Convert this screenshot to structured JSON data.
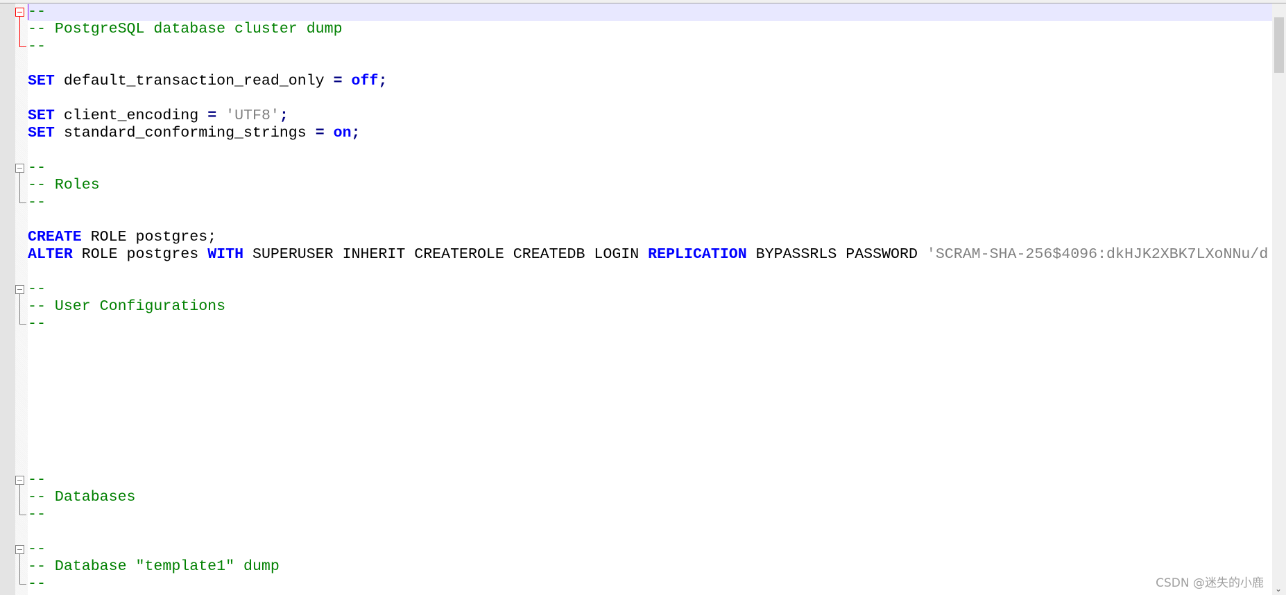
{
  "editor": {
    "lines": [
      [
        {
          "t": "--",
          "c": "cm"
        }
      ],
      [
        {
          "t": "-- PostgreSQL database cluster dump",
          "c": "cm"
        }
      ],
      [
        {
          "t": "--",
          "c": "cm"
        }
      ],
      [],
      [
        {
          "t": "SET",
          "c": "kw"
        },
        {
          "t": " default_transaction_read_only ",
          "c": ""
        },
        {
          "t": "=",
          "c": "op"
        },
        {
          "t": " ",
          "c": ""
        },
        {
          "t": "off",
          "c": "kw"
        },
        {
          "t": ";",
          "c": "op"
        }
      ],
      [],
      [
        {
          "t": "SET",
          "c": "kw"
        },
        {
          "t": " client_encoding ",
          "c": ""
        },
        {
          "t": "=",
          "c": "op"
        },
        {
          "t": " ",
          "c": ""
        },
        {
          "t": "'UTF8'",
          "c": "str"
        },
        {
          "t": ";",
          "c": "op"
        }
      ],
      [
        {
          "t": "SET",
          "c": "kw"
        },
        {
          "t": " standard_conforming_strings ",
          "c": ""
        },
        {
          "t": "=",
          "c": "op"
        },
        {
          "t": " ",
          "c": ""
        },
        {
          "t": "on",
          "c": "kw"
        },
        {
          "t": ";",
          "c": "op"
        }
      ],
      [],
      [
        {
          "t": "--",
          "c": "cm"
        }
      ],
      [
        {
          "t": "-- Roles",
          "c": "cm"
        }
      ],
      [
        {
          "t": "--",
          "c": "cm"
        }
      ],
      [],
      [
        {
          "t": "CREATE",
          "c": "kw"
        },
        {
          "t": " ROLE postgres;",
          "c": ""
        }
      ],
      [
        {
          "t": "ALTER",
          "c": "kw"
        },
        {
          "t": " ROLE postgres ",
          "c": ""
        },
        {
          "t": "WITH",
          "c": "kw"
        },
        {
          "t": " SUPERUSER INHERIT CREATEROLE CREATEDB LOGIN ",
          "c": ""
        },
        {
          "t": "REPLICATION",
          "c": "kw"
        },
        {
          "t": " BYPASSRLS PASSWORD ",
          "c": ""
        },
        {
          "t": "'SCRAM-SHA-256$4096:dkHJK2XBK7LXoNNu/d",
          "c": "str"
        }
      ],
      [],
      [
        {
          "t": "--",
          "c": "cm"
        }
      ],
      [
        {
          "t": "-- User Configurations",
          "c": "cm"
        }
      ],
      [
        {
          "t": "--",
          "c": "cm"
        }
      ],
      [],
      [],
      [],
      [],
      [],
      [],
      [],
      [],
      [
        {
          "t": "--",
          "c": "cm"
        }
      ],
      [
        {
          "t": "-- Databases",
          "c": "cm"
        }
      ],
      [
        {
          "t": "--",
          "c": "cm"
        }
      ],
      [],
      [
        {
          "t": "--",
          "c": "cm"
        }
      ],
      [
        {
          "t": "-- Database \"template1\" dump",
          "c": "cm"
        }
      ],
      [
        {
          "t": "--",
          "c": "cm"
        }
      ]
    ],
    "current_line": 0,
    "fold_blocks": [
      [
        0,
        2
      ],
      [
        9,
        11
      ],
      [
        16,
        18
      ],
      [
        27,
        29
      ],
      [
        31,
        33
      ]
    ]
  },
  "watermark": "CSDN @迷失的小鹿",
  "colors": {
    "keyword": "#0000ff",
    "comment": "#008000",
    "string": "#808080",
    "current_line": "#e8e8ff",
    "active_fold": "#ff0000"
  }
}
